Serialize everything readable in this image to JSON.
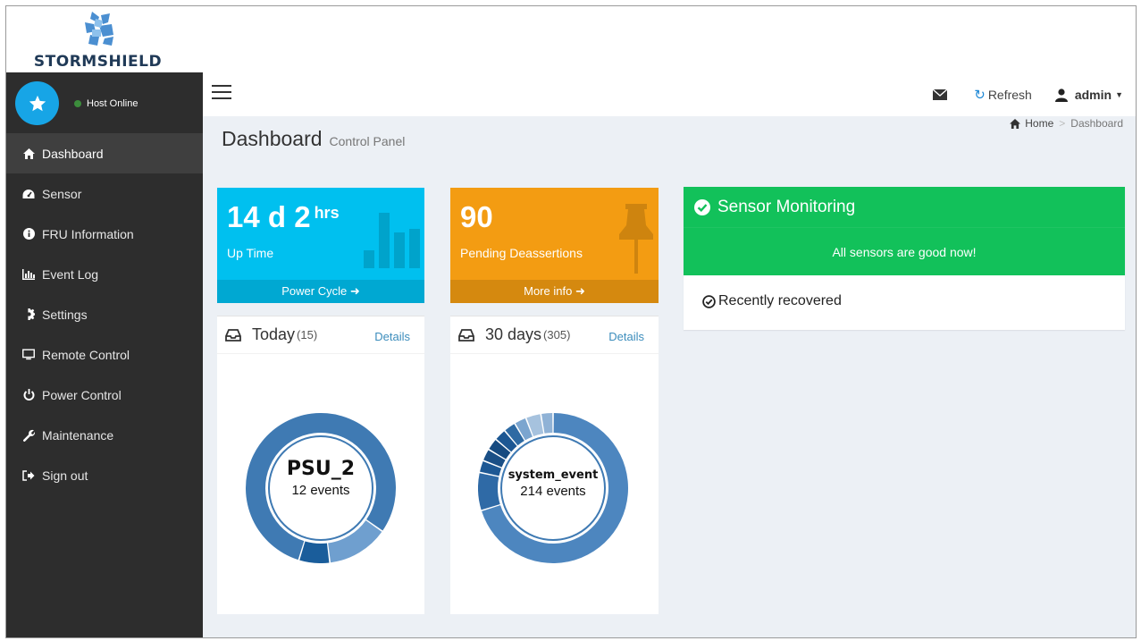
{
  "brand": {
    "name": "STORMSHIELD"
  },
  "sidebar": {
    "status": "Host Online",
    "items": [
      {
        "label": "Dashboard",
        "icon": "home-icon",
        "active": true
      },
      {
        "label": "Sensor",
        "icon": "dashboard-gauge-icon"
      },
      {
        "label": "FRU Information",
        "icon": "info-icon"
      },
      {
        "label": "Event Log",
        "icon": "bar-chart-icon"
      },
      {
        "label": "Settings",
        "icon": "gear-icon"
      },
      {
        "label": "Remote Control",
        "icon": "monitor-icon"
      },
      {
        "label": "Power Control",
        "icon": "power-icon"
      },
      {
        "label": "Maintenance",
        "icon": "wrench-icon"
      },
      {
        "label": "Sign out",
        "icon": "sign-out-icon"
      }
    ]
  },
  "header": {
    "refresh_label": "Refresh",
    "user_label": "admin"
  },
  "page": {
    "title": "Dashboard",
    "subtitle": "Control Panel",
    "breadcrumb": {
      "home": "Home",
      "current": "Dashboard"
    }
  },
  "uptime": {
    "value": "14 d 2",
    "unit": "hrs",
    "label": "Up Time",
    "footer": "Power Cycle"
  },
  "pending": {
    "value": "90",
    "label": "Pending Deassertions",
    "footer": "More info"
  },
  "today": {
    "title": "Today",
    "count": "(15)",
    "details": "Details",
    "center_name": "PSU_2",
    "center_events": "12 events",
    "segments": [
      12,
      2,
      1
    ],
    "colors": [
      "#3f7ab3",
      "#6f9fcf",
      "#1a5d9b"
    ]
  },
  "thirty": {
    "title": "30 days",
    "count": "(305)",
    "details": "Details",
    "center_name": "system_event",
    "center_events": "214 events",
    "segments": [
      214,
      25,
      8,
      8,
      8,
      8,
      8,
      8,
      10,
      8
    ],
    "colors": [
      "#4d86bf",
      "#2f6aa6",
      "#1d5894",
      "#1a4f86",
      "#164a80",
      "#1c5793",
      "#2e6aa3",
      "#7ba5cf",
      "#a6c2de",
      "#8fb2d6"
    ]
  },
  "sensor_monitoring": {
    "title": "Sensor Monitoring",
    "message": "All sensors are good now!",
    "recovered": "Recently recovered"
  },
  "colors": {
    "aqua": "#00c0ef",
    "orange": "#f39c12",
    "green": "#12c15a",
    "sidebar_bg": "#2d2d2d",
    "link": "#3c8dbc"
  }
}
